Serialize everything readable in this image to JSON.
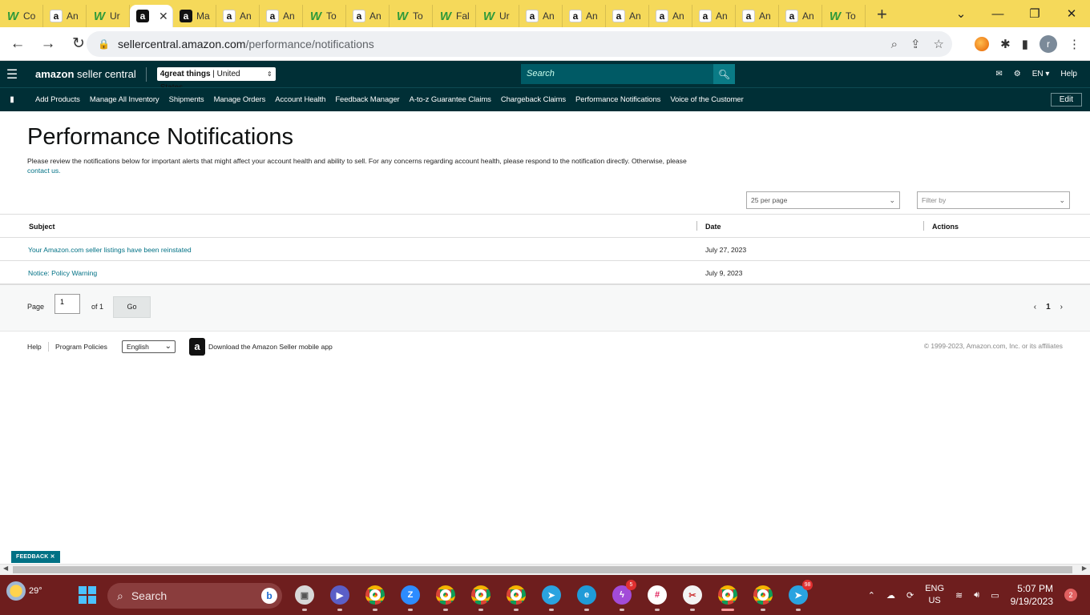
{
  "browser": {
    "tabs": [
      {
        "label": "Co",
        "favicon": "w"
      },
      {
        "label": "An",
        "favicon": "amz"
      },
      {
        "label": "Ur",
        "favicon": "w"
      },
      {
        "label": "",
        "favicon": "amz-dark",
        "active": true
      },
      {
        "label": "Ma",
        "favicon": "amz-dark"
      },
      {
        "label": "An",
        "favicon": "amz"
      },
      {
        "label": "An",
        "favicon": "amz"
      },
      {
        "label": "To",
        "favicon": "w"
      },
      {
        "label": "An",
        "favicon": "amz"
      },
      {
        "label": "To",
        "favicon": "w"
      },
      {
        "label": "Fal",
        "favicon": "w"
      },
      {
        "label": "Ur",
        "favicon": "w"
      },
      {
        "label": "An",
        "favicon": "amz"
      },
      {
        "label": "An",
        "favicon": "amz"
      },
      {
        "label": "An",
        "favicon": "amz"
      },
      {
        "label": "An",
        "favicon": "amz"
      },
      {
        "label": "An",
        "favicon": "amz"
      },
      {
        "label": "An",
        "favicon": "amz"
      },
      {
        "label": "An",
        "favicon": "amz"
      },
      {
        "label": "To",
        "favicon": "w"
      }
    ],
    "new_tab": "+",
    "url_host": "sellercentral.amazon.com",
    "url_path": "/performance/notifications",
    "profile_initial": "r"
  },
  "header": {
    "logo_brand": "amazon",
    "logo_rest": " seller central",
    "store_name": "4great things",
    "store_country": "United States",
    "search_placeholder": "Search",
    "language": "EN",
    "help": "Help"
  },
  "nav": {
    "links": [
      "Add Products",
      "Manage All Inventory",
      "Shipments",
      "Manage Orders",
      "Account Health",
      "Feedback Manager",
      "A-to-z Guarantee Claims",
      "Chargeback Claims",
      "Performance Notifications",
      "Voice of the Customer"
    ],
    "edit": "Edit"
  },
  "page": {
    "title": "Performance Notifications",
    "description": "Please review the notifications below for important alerts that might affect your account health and ability to sell. For any concerns regarding account health, please respond to the notification directly. Otherwise, please",
    "contact_link": "contact us.",
    "per_page": "25 per page",
    "filter_placeholder": "Filter by"
  },
  "table": {
    "headers": [
      "Subject",
      "Date",
      "Actions"
    ],
    "rows": [
      {
        "subject": "Your Amazon.com seller listings have been reinstated",
        "date": "July 27, 2023"
      },
      {
        "subject": "Notice: Policy Warning",
        "date": "July 9, 2023"
      }
    ]
  },
  "pagination": {
    "page_label": "Page",
    "page_value": "1",
    "of_label": "of 1",
    "go": "Go",
    "current": "1"
  },
  "footer": {
    "help": "Help",
    "policies": "Program Policies",
    "language": "English",
    "app": "Download the Amazon Seller mobile app",
    "copyright": "© 1999-2023, Amazon.com, Inc. or its affiliates"
  },
  "feedback": "FEEDBACK",
  "taskbar": {
    "temperature": "29°",
    "search": "Search",
    "apps": [
      {
        "name": "task-view",
        "label": ""
      },
      {
        "name": "meet",
        "label": ""
      },
      {
        "name": "chrome",
        "label": "A"
      },
      {
        "name": "zoom",
        "label": "Z"
      },
      {
        "name": "chrome",
        "label": ""
      },
      {
        "name": "chrome",
        "label": "D"
      },
      {
        "name": "chrome",
        "label": ""
      },
      {
        "name": "telegram",
        "label": ""
      },
      {
        "name": "edge",
        "label": ""
      },
      {
        "name": "messenger",
        "label": "",
        "badge": "5"
      },
      {
        "name": "slack",
        "label": ""
      },
      {
        "name": "snipping",
        "label": ""
      },
      {
        "name": "chrome",
        "label": "r",
        "active": true
      },
      {
        "name": "chrome",
        "label": "r"
      },
      {
        "name": "telegram",
        "label": "",
        "badge": "98"
      }
    ],
    "lang_top": "ENG",
    "lang_bottom": "US",
    "time": "5:07 PM",
    "date": "9/19/2023",
    "notifications": "2"
  }
}
